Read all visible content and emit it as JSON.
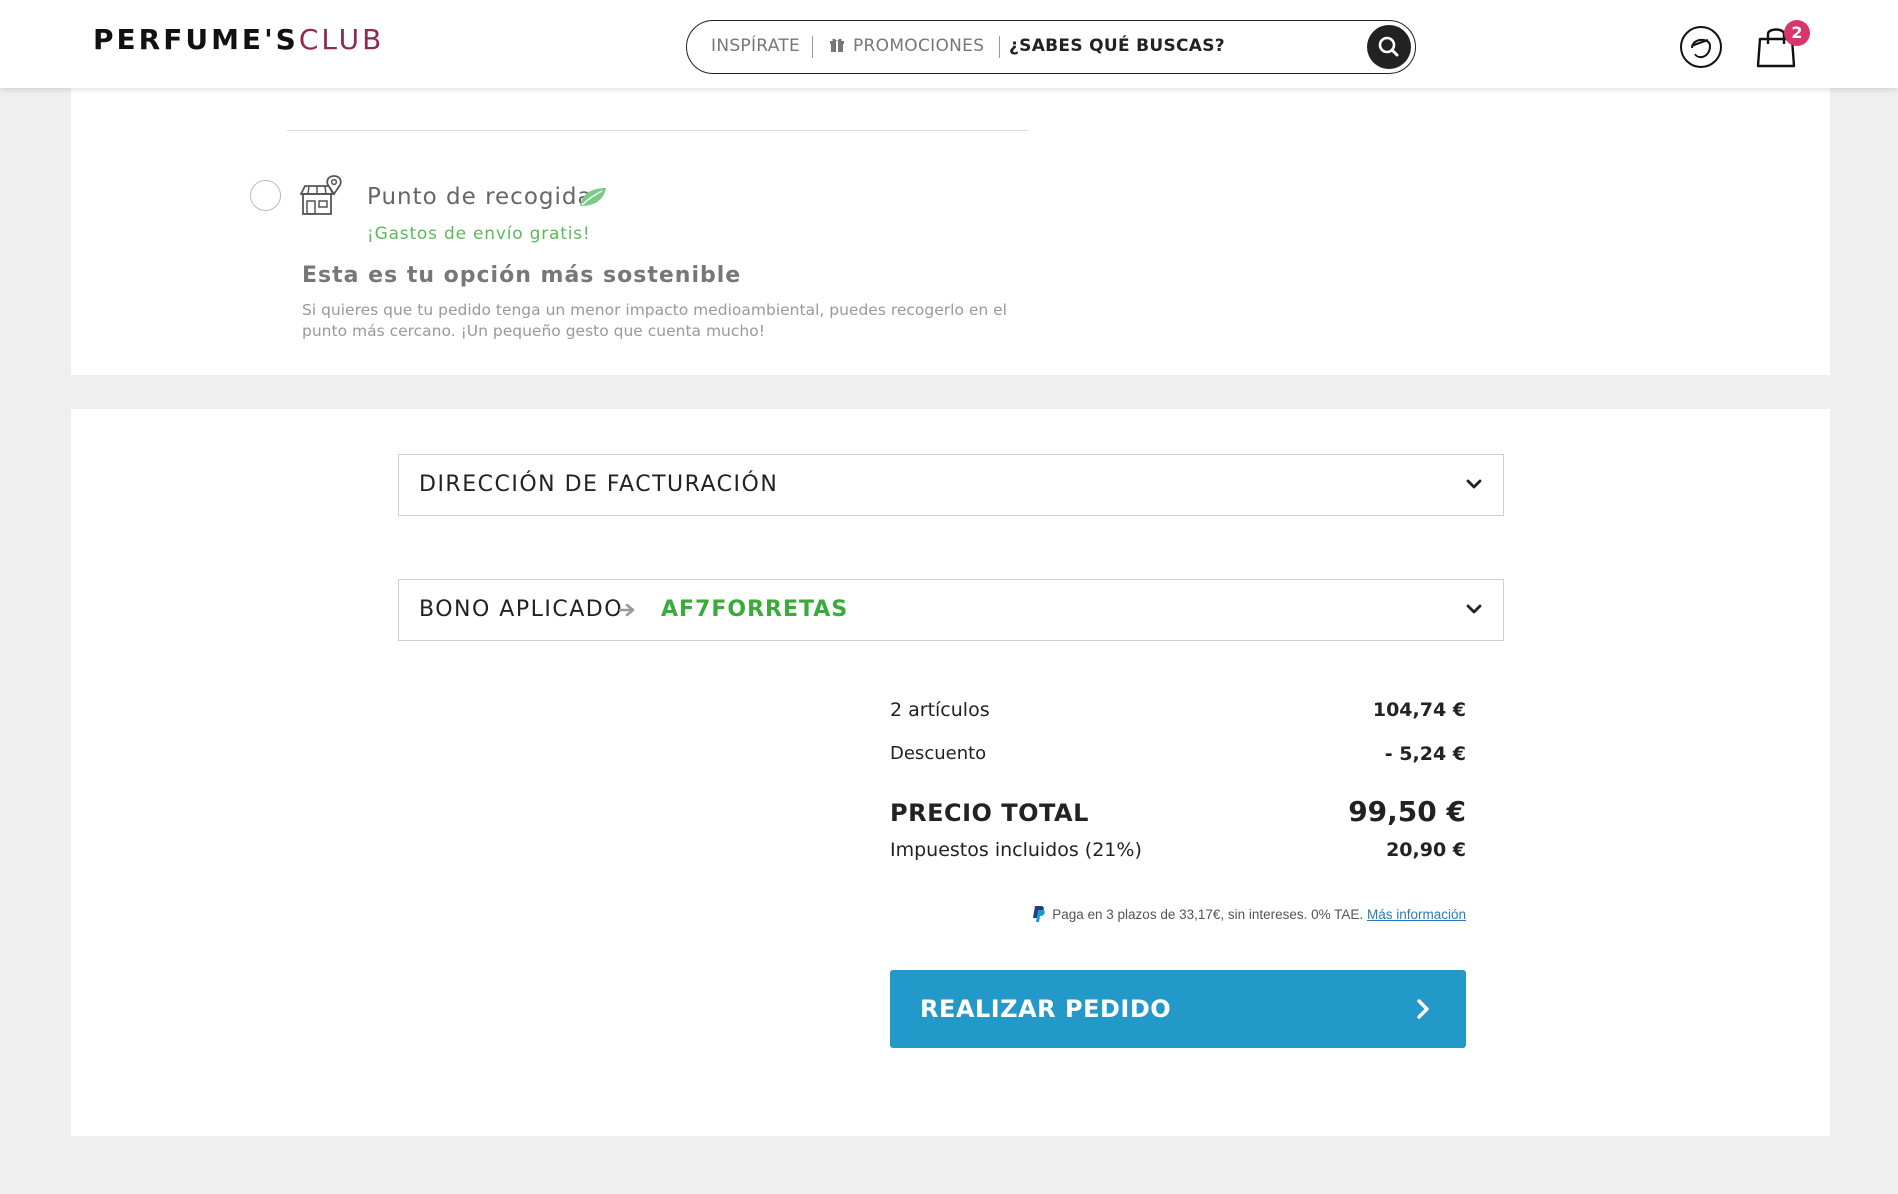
{
  "header": {
    "logo": {
      "part1": "PERFUME'S",
      "part2": "CLUB"
    },
    "search": {
      "inspirate": "INSPÍRATE",
      "promociones": "PROMOCIONES",
      "search_label": "¿SABES QUÉ BUSCAS?"
    },
    "cart_count": "2",
    "icons": [
      "search-icon",
      "user-icon",
      "bag-icon",
      "gift-icon"
    ]
  },
  "shipping": {
    "option_label": "Punto de recogida",
    "free_shipping": "¡Gastos de envío gratis!",
    "sustainable_title": "Esta es tu opción más sostenible",
    "sustainable_text": "Si quieres que tu pedido tenga un menor impacto medioambiental, puedes recogerlo en el punto más cercano. ¡Un pequeño gesto que cuenta mucho!",
    "selected": false
  },
  "billing": {
    "label": "DIRECCIÓN DE FACTURACIÓN"
  },
  "voucher": {
    "label": "BONO APLICADO",
    "code": "AF7FORRETAS"
  },
  "summary": {
    "items_label": "2 artículos",
    "items_value": "104,74 €",
    "discount_label": "Descuento",
    "discount_value": "- 5,24 €",
    "total_label": "PRECIO TOTAL",
    "total_value": "99,50 €",
    "tax_label": "Impuestos incluidos (21%)",
    "tax_value": "20,90 €"
  },
  "paypal": {
    "text": "Paga en 3 plazos de 33,17€, sin intereses. 0% TAE.",
    "link": "Más información"
  },
  "cta": {
    "label": "REALIZAR PEDIDO"
  },
  "colors": {
    "accent": "#2299c8",
    "brand": "#8c2a54",
    "success": "#3aaa3a",
    "badge": "#d8356c"
  }
}
